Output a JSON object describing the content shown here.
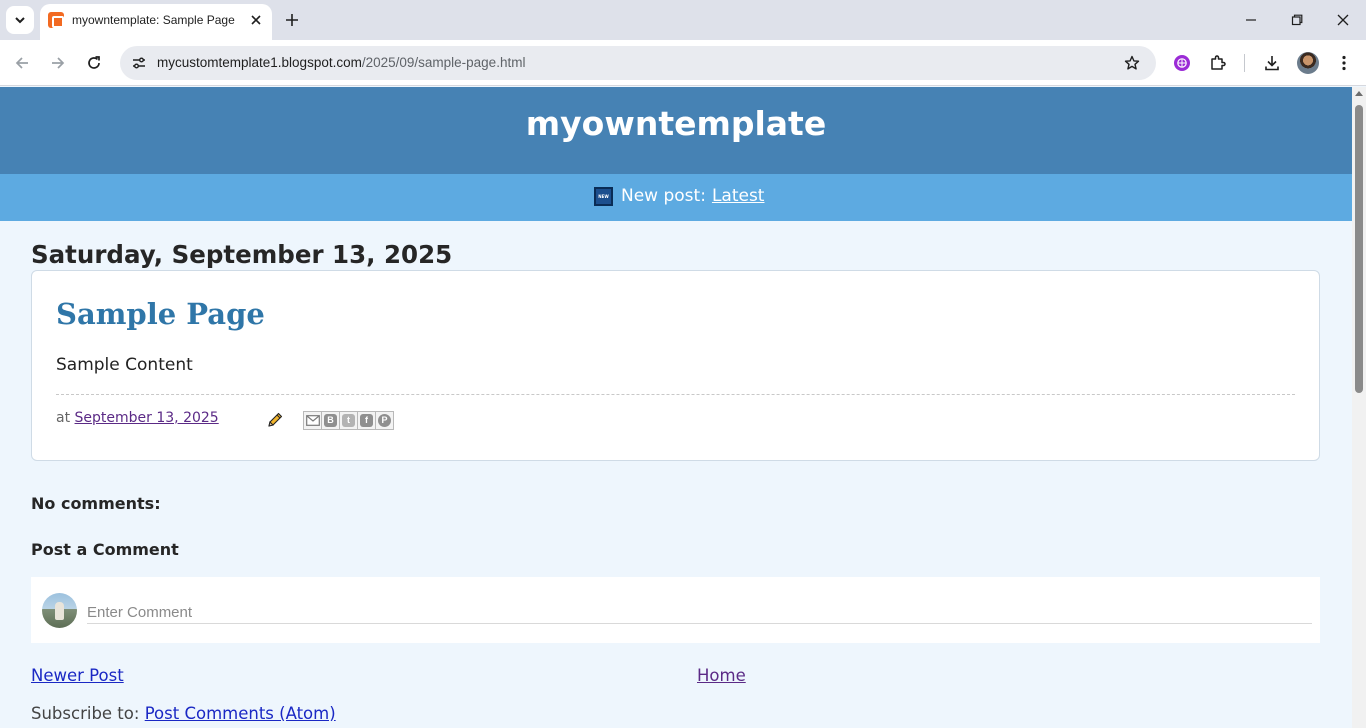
{
  "browser": {
    "tab_title": "myowntemplate: Sample Page",
    "url_host": "mycustomtemplate1.blogspot.com",
    "url_path": "/2025/09/sample-page.html"
  },
  "blog": {
    "title": "myowntemplate"
  },
  "announcement": {
    "prefix": "New post:",
    "link_label": "Latest"
  },
  "post": {
    "date_header": "Saturday, September 13, 2025",
    "title": "Sample Page",
    "content": "Sample Content",
    "footer_prefix": "at",
    "timestamp_link": "September 13, 2025",
    "share_buttons": [
      "Email",
      "Blogger",
      "Twitter",
      "Facebook",
      "Pinterest"
    ]
  },
  "comments": {
    "count_heading": "No comments:",
    "form_heading": "Post a Comment",
    "input_placeholder": "Enter Comment"
  },
  "pager": {
    "newer_label": "Newer Post",
    "home_label": "Home"
  },
  "feed": {
    "prefix": "Subscribe to:",
    "link_label": "Post Comments (Atom)"
  },
  "colors": {
    "header_bg": "#4682b4",
    "announce_bg": "#5daae1",
    "page_bg": "#eef6fd",
    "post_title": "#2f76a8",
    "link": "#1a28c4",
    "visited_link": "#5b2a86"
  }
}
